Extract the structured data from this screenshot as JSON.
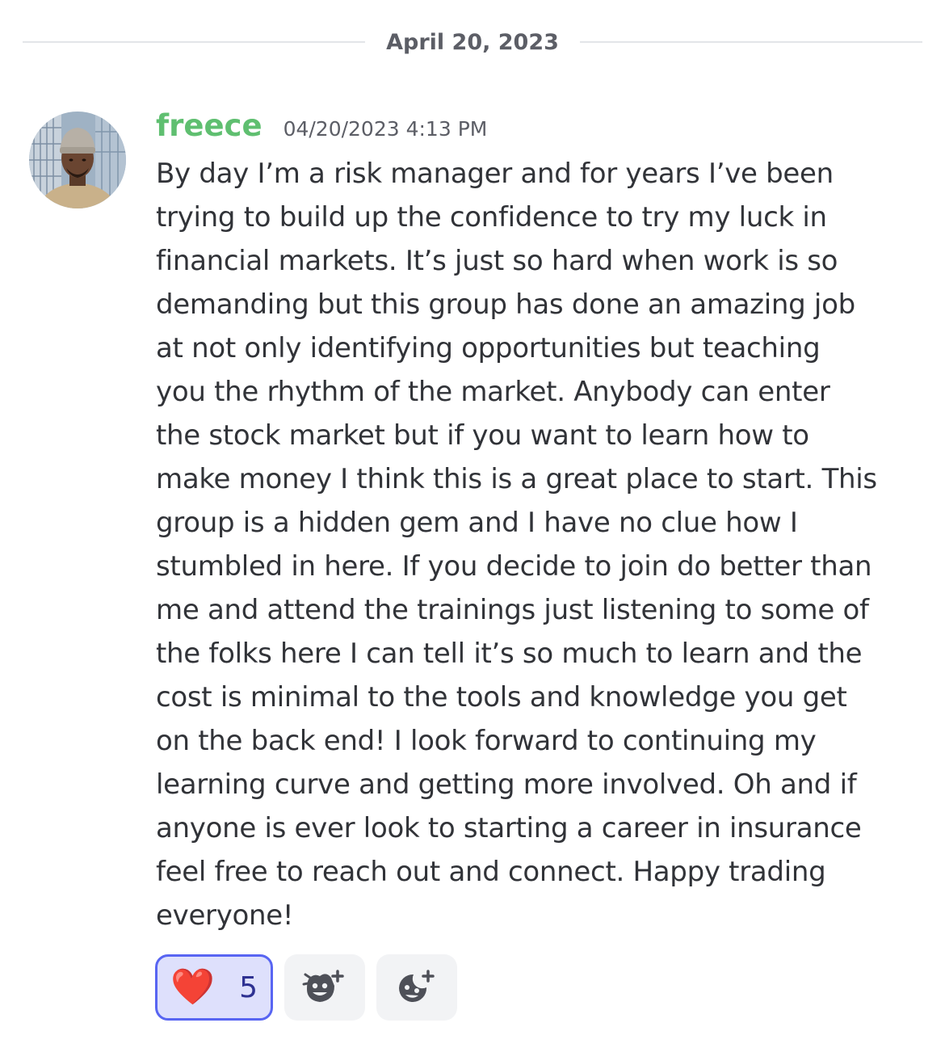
{
  "date_divider": {
    "text": "April 20, 2023"
  },
  "message": {
    "username": "freece",
    "timestamp": "04/20/2023 4:13 PM",
    "lines": [
      "By day I’m a risk manager and for years I’ve been",
      "trying to build up the confidence to try my luck in",
      "financial markets. It’s just so hard when work is so",
      "demanding but this group has done an amazing job",
      "at not only identifying opportunities but teaching",
      "you the rhythm of the market. Anybody can enter",
      "the stock market but if you want to learn how to",
      "make money I think this is a great place to start. This",
      "group is a hidden gem and I have no clue how I",
      "stumbled in here. If you decide to join do better than",
      "me and attend the trainings just listening to some of",
      "the folks here I can tell it’s so much to learn and the",
      "cost is minimal to the tools and knowledge you get",
      "on the back end! I look forward to continuing my",
      "learning curve and getting more involved. Oh and if",
      "anyone is ever look to starting a career in insurance",
      "feel free to reach out and connect. Happy trading",
      "everyone!"
    ]
  },
  "reactions": {
    "heart": {
      "emoji": "❤️",
      "count": "5",
      "icon": "heart-emoji"
    },
    "add_reaction_icon": "add-reaction-icon",
    "add_super_reaction_icon": "add-super-reaction-icon"
  },
  "colors": {
    "username": "#5fbf70",
    "reaction_active_bg": "#dee0fc",
    "reaction_active_border": "#5865f2"
  }
}
